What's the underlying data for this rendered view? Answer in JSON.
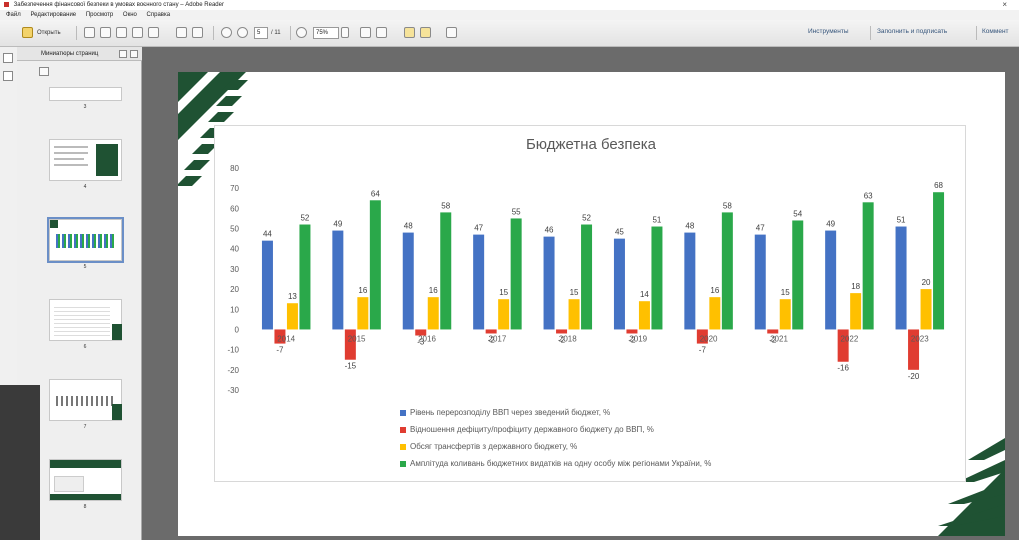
{
  "window": {
    "title": "Забезпечення фінансової безпеки в умовах воєнного стану – Adobe Reader",
    "close_glyph": "×"
  },
  "menu": [
    "Файл",
    "Редактирование",
    "Просмотр",
    "Окно",
    "Справка"
  ],
  "toolbar": {
    "open_label": "Открыть",
    "page_current": "5",
    "page_total": "/ 11",
    "zoom": "75%",
    "tools_label": "Инструменты",
    "sign_label": "Заполнить и подписать",
    "comment_label": "Коммент"
  },
  "sidebar": {
    "title": "Миниатюры страниц",
    "thumbnails": [
      {
        "page": "3"
      },
      {
        "page": "4"
      },
      {
        "page": "5",
        "selected": true
      },
      {
        "page": "6"
      },
      {
        "page": "7"
      },
      {
        "page": "8"
      }
    ]
  },
  "colors": {
    "blue": "#4472c4",
    "red": "#e03c31",
    "yellow": "#ffc000",
    "green": "#2aa84a",
    "page_accent": "#1f5233"
  },
  "chart_data": {
    "type": "bar",
    "title": "Бюджетна безпека",
    "categories": [
      "2014",
      "2015",
      "2016",
      "2017",
      "2018",
      "2019",
      "2020",
      "2021",
      "2022",
      "2023"
    ],
    "ylim": [
      -30,
      80
    ],
    "yticks": [
      -30,
      -20,
      -10,
      0,
      10,
      20,
      30,
      40,
      50,
      60,
      70,
      80
    ],
    "grid": false,
    "legend_position": "bottom",
    "series": [
      {
        "name": "Рівень перерозподілу ВВП через зведений бюджет, %",
        "color": "#4472c4",
        "values": [
          44,
          49,
          48,
          47,
          46,
          45,
          48,
          47,
          49,
          51
        ]
      },
      {
        "name": "Відношення дефіциту/профіциту державного бюджету до ВВП, %",
        "color": "#e03c31",
        "values": [
          -7,
          -15,
          -3,
          -2,
          -2,
          -2,
          -7,
          -2,
          -16,
          -20
        ]
      },
      {
        "name": "Обсяг трансфертів з державного бюджету, %",
        "color": "#ffc000",
        "values": [
          13,
          16,
          16,
          15,
          15,
          14,
          16,
          15,
          18,
          20
        ]
      },
      {
        "name": "Амплітуда коливань бюджетних видатків на одну особу між регіонами України, %",
        "color": "#2aa84a",
        "values": [
          52,
          64,
          58,
          55,
          52,
          51,
          58,
          54,
          63,
          68
        ]
      }
    ]
  }
}
